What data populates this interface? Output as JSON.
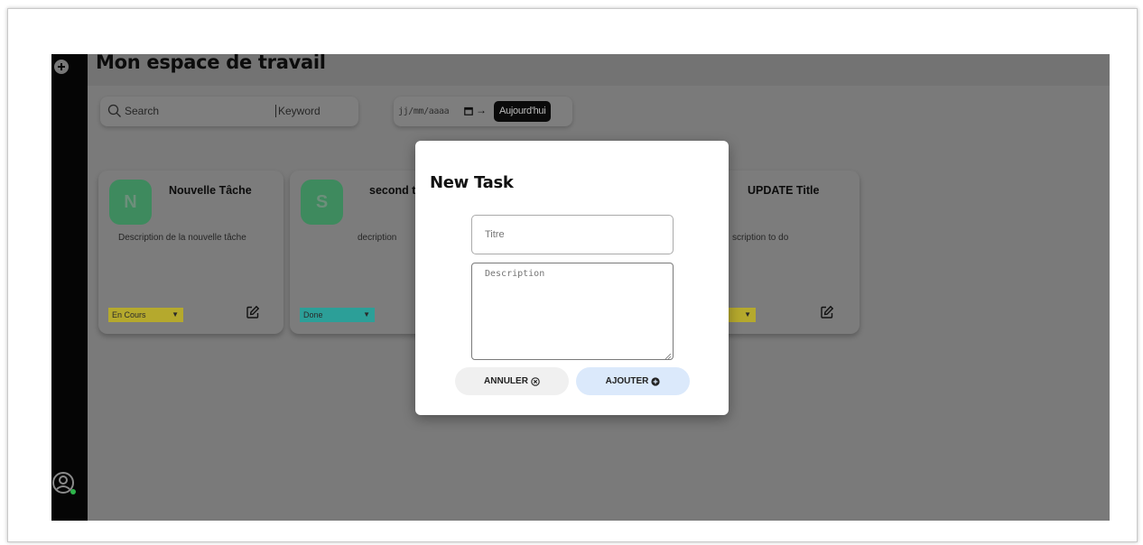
{
  "workspace": {
    "title": "Mon espace de travail"
  },
  "search": {
    "placeholder": "Search",
    "keyword_label": "Keyword"
  },
  "date_filter": {
    "placeholder": "jj/mm/aaaa",
    "today_label": "Aujourd'hui"
  },
  "cards": [
    {
      "initial": "N",
      "title": "Nouvelle Tâche",
      "description": "Description de la nouvelle tâche",
      "status": "En Cours",
      "status_color": "#b5a92d"
    },
    {
      "initial": "S",
      "title": "second ti",
      "description": "decription",
      "status": "Done",
      "status_color": "#2c9f98"
    },
    {
      "initial": "",
      "title": "UPDATE Title",
      "description": "scription to do",
      "status": "",
      "status_color": "#b5a92d"
    }
  ],
  "modal": {
    "title": "New Task",
    "title_placeholder": "Titre",
    "description_placeholder": "Description",
    "cancel_label": "ANNULER",
    "add_label": "AJOUTER"
  },
  "colors": {
    "overlay": "#7a7a7a",
    "sidebar": "#050505",
    "avatar_tile": "#3e8a5e",
    "add_button": "#dbe9fb",
    "online_dot": "#2db54a"
  },
  "icons": {
    "sidebar_top": "plus-circle-icon",
    "sidebar_bottom": "user-circle-icon",
    "search": "search-icon",
    "calendar": "calendar-icon",
    "edit": "edit-icon",
    "cancel": "x-circle-icon",
    "add": "plus-circle-icon"
  }
}
